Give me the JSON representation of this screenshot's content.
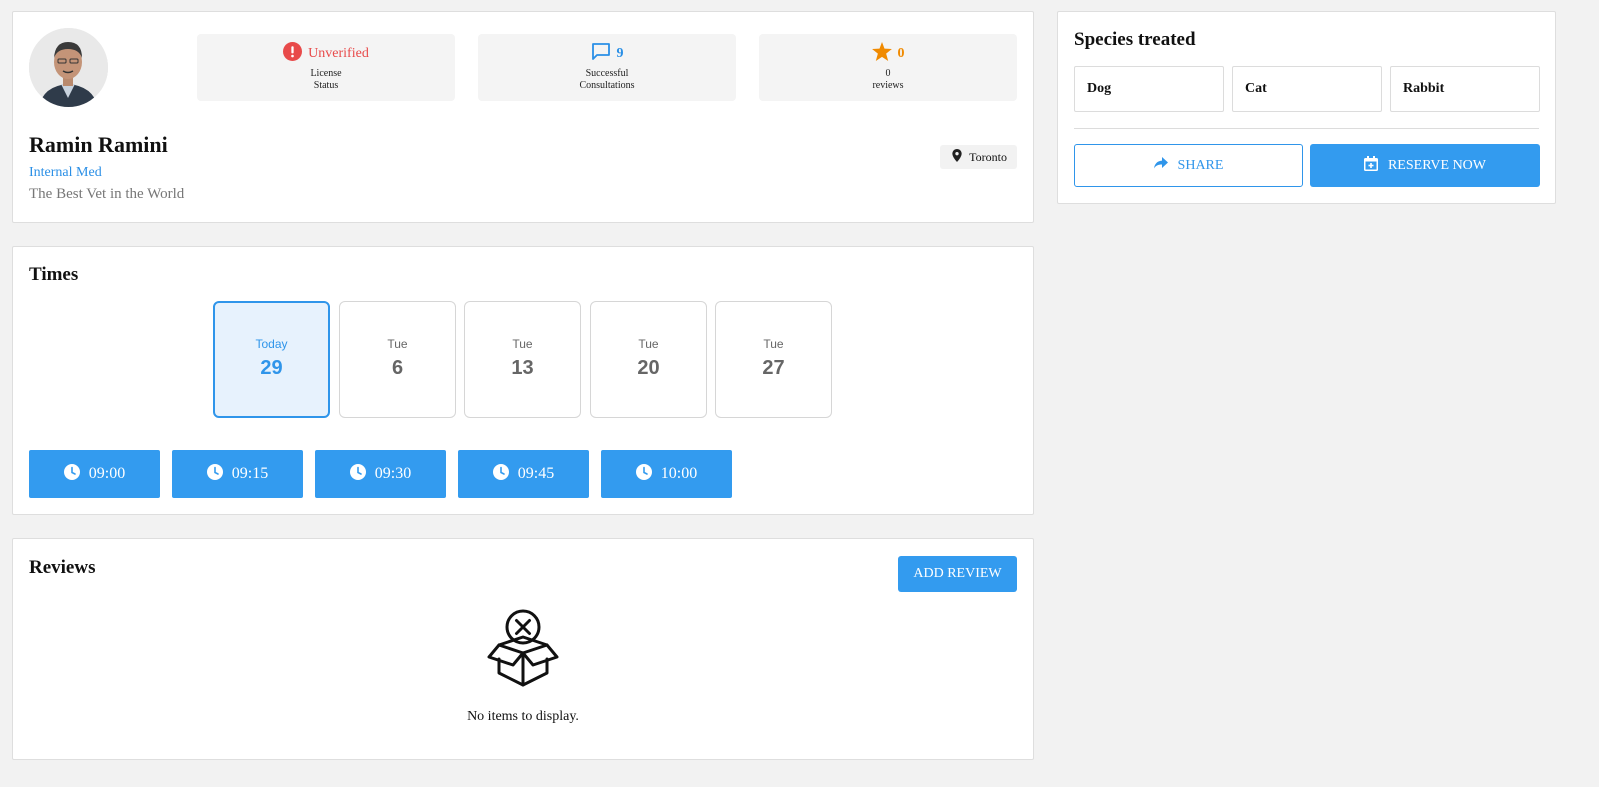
{
  "profile": {
    "name": "Ramin Ramini",
    "specialty": "Internal Med",
    "tagline": "The Best Vet in the World",
    "location": "Toronto",
    "stats": {
      "license": {
        "value": "Unverified",
        "caption_line1": "License",
        "caption_line2": "Status",
        "color": "#e84a4a",
        "icon": "alert-circle-icon"
      },
      "consultations": {
        "value": "9",
        "caption_line1": "Successful",
        "caption_line2": "Consultations",
        "color": "#2a8fe6",
        "icon": "chat-bubble-icon"
      },
      "reviews": {
        "value": "0",
        "caption_line1": "0",
        "caption_line2": "reviews",
        "color": "#f08a00",
        "icon": "star-icon"
      }
    }
  },
  "species": {
    "title": "Species treated",
    "items": [
      "Dog",
      "Cat",
      "Rabbit"
    ],
    "share_label": "SHARE",
    "reserve_label": "RESERVE NOW"
  },
  "times": {
    "title": "Times",
    "days": [
      {
        "name": "Today",
        "num": "29"
      },
      {
        "name": "Tue",
        "num": "6"
      },
      {
        "name": "Tue",
        "num": "13"
      },
      {
        "name": "Tue",
        "num": "20"
      },
      {
        "name": "Tue",
        "num": "27"
      }
    ],
    "slots": [
      "09:00",
      "09:15",
      "09:30",
      "09:45",
      "10:00"
    ]
  },
  "reviews": {
    "title": "Reviews",
    "add_label": "ADD REVIEW",
    "empty_text": "No items to display."
  },
  "colors": {
    "primary": "#339bef",
    "background": "#f2f2f2"
  }
}
